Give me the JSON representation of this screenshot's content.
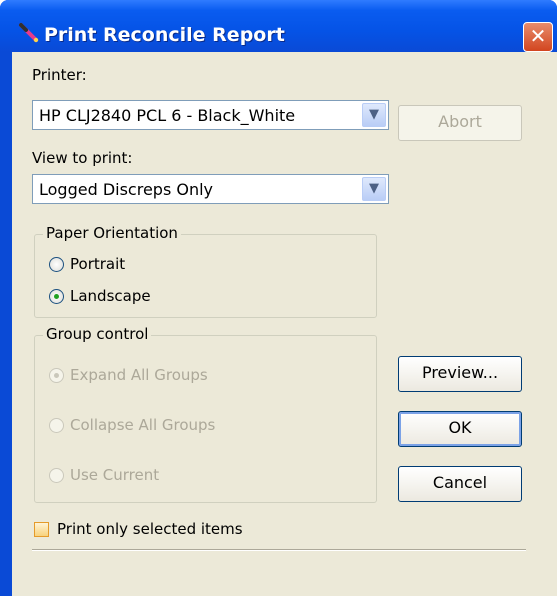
{
  "window": {
    "title": "Print Reconcile Report",
    "close_glyph": "✕",
    "icon": "pen-icon"
  },
  "printer": {
    "label": "Printer:",
    "value": "HP CLJ2840 PCL 6 - Black_White"
  },
  "view": {
    "label": "View to print:",
    "value": "Logged Discreps Only"
  },
  "orientation": {
    "legend": "Paper Orientation",
    "portrait": "Portrait",
    "landscape": "Landscape",
    "selected": "Landscape"
  },
  "group_control": {
    "legend": "Group control",
    "expand": "Expand All Groups",
    "collapse": "Collapse All Groups",
    "current": "Use Current",
    "selected": "Expand All Groups",
    "enabled": false
  },
  "print_selected": {
    "label": "Print only selected items",
    "checked": false
  },
  "buttons": {
    "abort": "Abort",
    "preview": "Preview...",
    "ok": "OK",
    "cancel": "Cancel"
  },
  "colors": {
    "title_bar": "#0a5cf0",
    "dialog_face": "#ece9d8",
    "close_button": "#d2451f"
  }
}
